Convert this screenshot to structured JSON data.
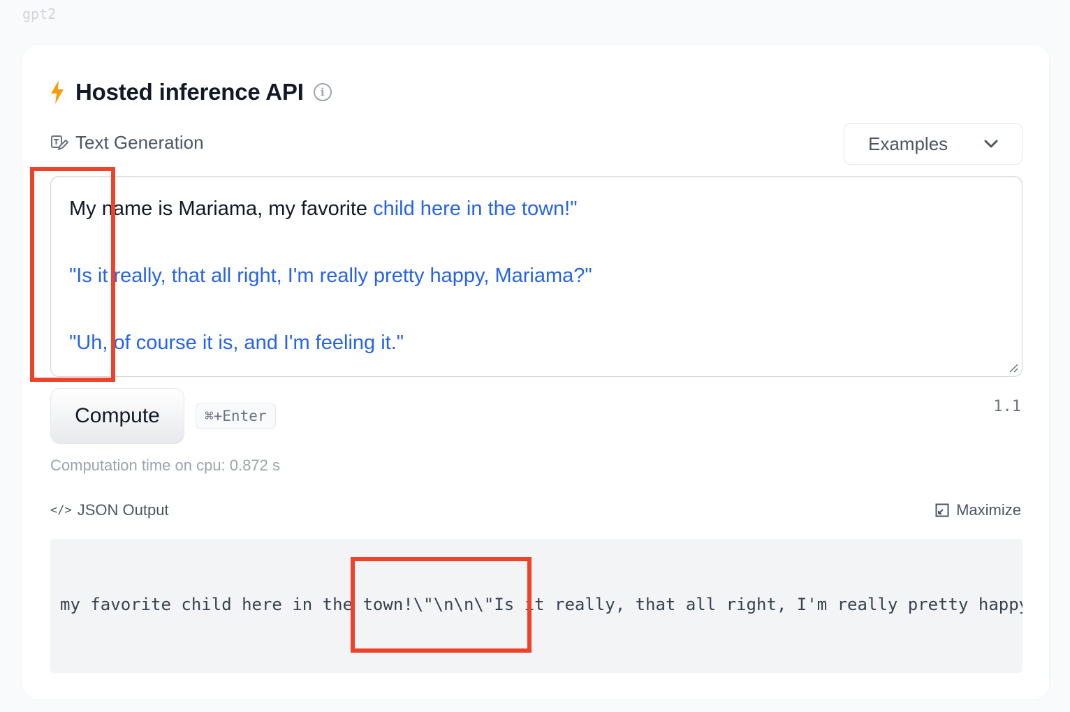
{
  "model_name": "gpt2",
  "widget": {
    "title": "Hosted inference API",
    "task_label": "Text Generation",
    "examples_label": "Examples"
  },
  "input": {
    "prompt_text": "My name is Mariama, my favorite ",
    "generated_line_1": "child here in the town!\"",
    "generated_line_2": "\"Is it really, that all right, I'm really pretty happy, Mariama?\"",
    "generated_line_3": "\"Uh, of course it is, and I'm feeling it.\""
  },
  "actions": {
    "compute_label": "Compute",
    "shortcut_label": "⌘+Enter",
    "version": "1.1"
  },
  "status": {
    "computation_time": "Computation time on cpu: 0.872 s"
  },
  "output": {
    "json_label": "JSON Output",
    "maximize_label": "Maximize",
    "json_text": "my favorite child here in the town!\\\"\\n\\n\\\"Is it really, that all right, I'm really pretty happy"
  },
  "colors": {
    "accent_bolt": "#f59e0b",
    "generated_text": "#2563eb",
    "annotation": "#ee4229"
  },
  "icons": {
    "bolt": "lightning-bolt-icon",
    "info": "info-icon",
    "task": "text-generation-icon",
    "dropdown": "chevron-down-icon",
    "code": "code-icon",
    "maximize": "maximize-icon"
  }
}
